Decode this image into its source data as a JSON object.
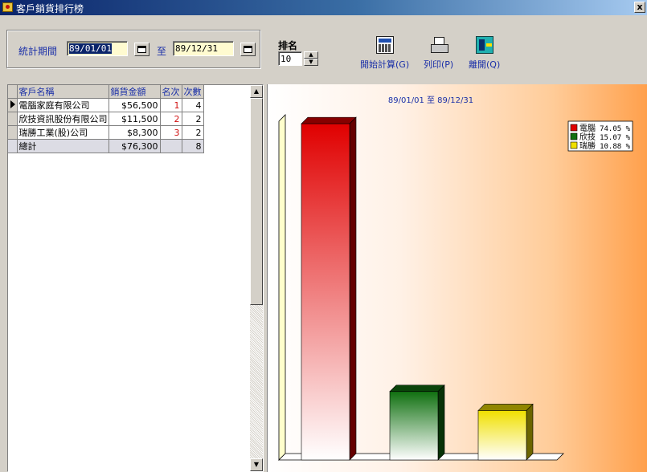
{
  "window": {
    "title": "客戶銷貨排行榜",
    "close_glyph": "x"
  },
  "toolbar": {
    "period_label": "統計期間",
    "date_from": "89/01/01",
    "to_label": "至",
    "date_to": "89/12/31",
    "rank_label": "排名",
    "rank_value": "10",
    "calc_label": "開始計算(G)",
    "print_label": "列印(P)",
    "exit_label": "離開(Q)"
  },
  "grid": {
    "columns": [
      "客戶名稱",
      "銷貨金額",
      "名次",
      "次數"
    ],
    "rows": [
      {
        "name": "電腦家庭有限公司",
        "amount": "$56,500",
        "rank": "1",
        "count": "4"
      },
      {
        "name": "欣技資訊股份有限公司",
        "amount": "$11,500",
        "rank": "2",
        "count": "2"
      },
      {
        "name": "瑞勝工業(股)公司",
        "amount": "$8,300",
        "rank": "3",
        "count": "2"
      }
    ],
    "total": {
      "label": "總計",
      "amount": "$76,300",
      "count": "8"
    }
  },
  "chart_data": {
    "type": "bar",
    "title": "89/01/01 至 89/12/31",
    "categories": [
      "電腦",
      "欣技",
      "瑞勝"
    ],
    "values": [
      56500,
      11500,
      8300
    ],
    "percent_labels": [
      "74.05 %",
      "15.07 %",
      "10.88 %"
    ],
    "colors": [
      "#e00000",
      "#107010",
      "#f0e000"
    ],
    "ylim": [
      0,
      58000
    ],
    "legend_position": "top-right",
    "grid": false
  }
}
